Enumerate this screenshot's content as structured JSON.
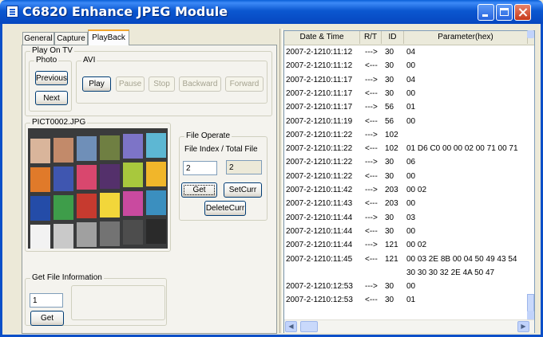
{
  "window": {
    "title": "C6820 Enhance JPEG Module"
  },
  "tabs": [
    {
      "label": "General"
    },
    {
      "label": "Capture"
    },
    {
      "label": "PlayBack"
    }
  ],
  "playback": {
    "play_on_tv_label": "Play On TV",
    "photo_label": "Photo",
    "previous_label": "Previous",
    "next_label": "Next",
    "avi_label": "AVI",
    "play_label": "Play",
    "pause_label": "Pause",
    "stop_label": "Stop",
    "backward_label": "Backward",
    "forward_label": "Forward",
    "image_name": "PICT0002.JPG",
    "file_operate_label": "File Operate",
    "file_index_label": "File Index  / Total File",
    "file_index_value": "2",
    "total_file_value": "2",
    "get_label": "Get",
    "setcurr_label": "SetCurr",
    "deletecurr_label": "DeleteCurr",
    "get_file_info_label": "Get File Information",
    "file_info_input": "1",
    "file_info_get_label": "Get"
  },
  "colors": {
    "titlebar": "#0b57d0",
    "patches": [
      "#d9b59b",
      "#c28a6a",
      "#6f8fb8",
      "#6f7f42",
      "#7d74c7",
      "#5db7d3",
      "#e07a2a",
      "#3f56b0",
      "#d9476e",
      "#54306b",
      "#a8c83d",
      "#f1b62a",
      "#244ca8",
      "#3e9d4a",
      "#c63a2f",
      "#f2d63a",
      "#c94a9f",
      "#3b8fbf",
      "#f2f2f2",
      "#c9c9c9",
      "#a0a0a0",
      "#737373",
      "#4d4d4d",
      "#2a2a2a"
    ]
  },
  "log": {
    "columns": [
      "Date & Time",
      "R/T",
      "ID",
      "Parameter(hex)"
    ],
    "rows": [
      {
        "date": "2007-2-12",
        "time": "10:11:12",
        "dir": "--->",
        "id": "30",
        "param": "04"
      },
      {
        "date": "2007-2-12",
        "time": "10:11:12",
        "dir": "<---",
        "id": "30",
        "param": "00"
      },
      {
        "date": "2007-2-12",
        "time": "10:11:17",
        "dir": "--->",
        "id": "30",
        "param": "04"
      },
      {
        "date": "2007-2-12",
        "time": "10:11:17",
        "dir": "<---",
        "id": "30",
        "param": "00"
      },
      {
        "date": "2007-2-12",
        "time": "10:11:17",
        "dir": "--->",
        "id": "56",
        "param": "01"
      },
      {
        "date": "2007-2-12",
        "time": "10:11:19",
        "dir": "<---",
        "id": "56",
        "param": "00"
      },
      {
        "date": "2007-2-12",
        "time": "10:11:22",
        "dir": "--->",
        "id": "102",
        "param": ""
      },
      {
        "date": "2007-2-12",
        "time": "10:11:22",
        "dir": "<---",
        "id": "102",
        "param": "01 D6 C0 00 00 02 00 71 00 71"
      },
      {
        "date": "2007-2-12",
        "time": "10:11:22",
        "dir": "--->",
        "id": "30",
        "param": "06"
      },
      {
        "date": "2007-2-12",
        "time": "10:11:22",
        "dir": "<---",
        "id": "30",
        "param": "00"
      },
      {
        "date": "2007-2-12",
        "time": "10:11:42",
        "dir": "--->",
        "id": "203",
        "param": "00 02"
      },
      {
        "date": "2007-2-12",
        "time": "10:11:43",
        "dir": "<---",
        "id": "203",
        "param": "00"
      },
      {
        "date": "2007-2-12",
        "time": "10:11:44",
        "dir": "--->",
        "id": "30",
        "param": "03"
      },
      {
        "date": "2007-2-12",
        "time": "10:11:44",
        "dir": "<---",
        "id": "30",
        "param": "00"
      },
      {
        "date": "2007-2-12",
        "time": "10:11:44",
        "dir": "--->",
        "id": "121",
        "param": "00 02"
      },
      {
        "date": "2007-2-12",
        "time": "10:11:45",
        "dir": "<---",
        "id": "121",
        "param": "00 03 2E 8B 00 04 50 49 43 54"
      },
      {
        "date": "",
        "time": "",
        "dir": "",
        "id": "",
        "param": "30 30 30 32 2E 4A 50 47"
      },
      {
        "date": "2007-2-12",
        "time": "10:12:53",
        "dir": "--->",
        "id": "30",
        "param": "00"
      },
      {
        "date": "2007-2-12",
        "time": "10:12:53",
        "dir": "<---",
        "id": "30",
        "param": "01"
      }
    ]
  }
}
